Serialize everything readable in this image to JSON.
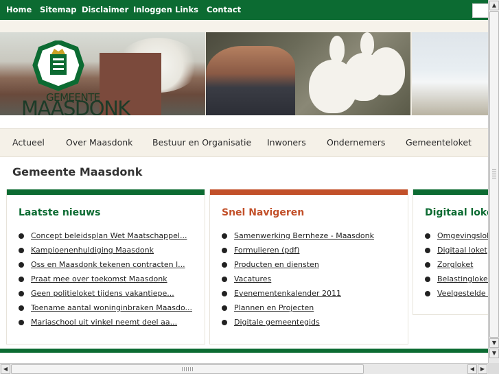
{
  "top_nav": {
    "items": [
      "Home",
      "Sitemap",
      "Disclaimer",
      "Inloggen",
      "Links",
      "Contact"
    ]
  },
  "logo": {
    "line1": "GEMEENTE",
    "line2": "MAASDONK",
    "color": "#0c6b32"
  },
  "sub_nav": {
    "items": [
      "Actueel",
      "Over Maasdonk",
      "Bestuur en Organisatie",
      "Inwoners",
      "Ondernemers",
      "Gemeenteloket"
    ]
  },
  "page_title": "Gemeente Maasdonk",
  "panels": [
    {
      "title": "Laatste nieuws",
      "accent": "#0c6b32",
      "title_color": "#0c6b32",
      "items": [
        "Concept beleidsplan Wet Maatschappel...",
        "Kampioenenhuldiging Maasdonk",
        "Oss en Maasdonk tekenen contracten l...",
        "Praat mee over toekomst Maasdonk",
        "Geen politieloket tijdens vakantiepe...",
        "Toename aantal woninginbraken Maasdo...",
        "Mariaschool uit vinkel neemt deel aa..."
      ]
    },
    {
      "title": "Snel Navigeren",
      "accent": "#c2502a",
      "title_color": "#c2502a",
      "items": [
        "Samenwerking Bernheze - Maasdonk",
        "Formulieren (pdf)",
        "Producten en diensten",
        "Vacatures",
        "Evenementenkalender 2011",
        "Plannen en Projecten",
        "Digitale gemeentegids"
      ]
    },
    {
      "title": "Digitaal loket",
      "accent": "#0c6b32",
      "title_color": "#0c6b32",
      "items": [
        "Omgevingsloket",
        "Digitaal loket",
        "Zorgloket",
        "Belastingloket",
        "Veelgestelde vragen"
      ]
    }
  ]
}
